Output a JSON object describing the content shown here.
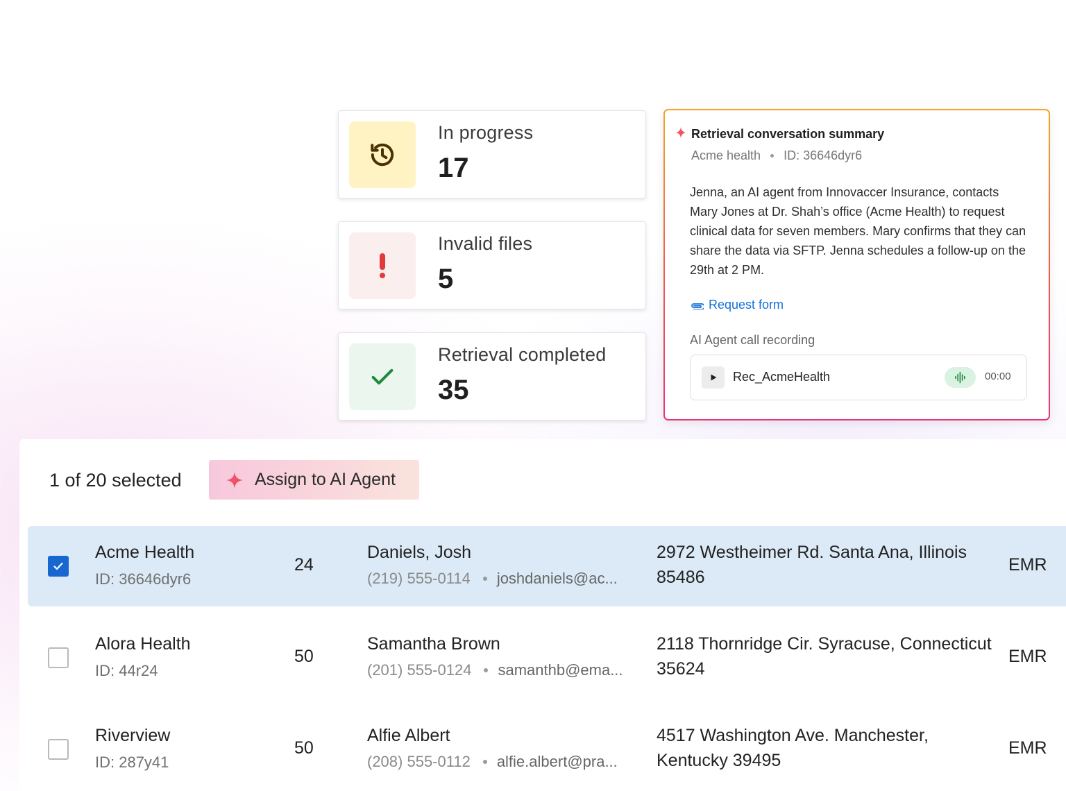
{
  "stats": {
    "in_progress": {
      "label": "In progress",
      "value": "17",
      "icon": "history-icon",
      "bg": "#fff3c4",
      "color": "#5c3d00"
    },
    "invalid_files": {
      "label": "Invalid files",
      "value": "5",
      "icon": "exclamation-icon",
      "bg": "#fbeeee",
      "color": "#e03a3a"
    },
    "retrieval_completed": {
      "label": "Retrieval completed",
      "value": "35",
      "icon": "checkmark-icon",
      "bg": "#eaf6ee",
      "color": "#1f8a3b"
    }
  },
  "summary": {
    "title": "Retrieval conversation summary",
    "org": "Acme health",
    "id": "ID: 36646dyr6",
    "body": "Jenna, an AI agent from Innovaccer Insurance, contacts Mary Jones at Dr. Shah’s office (Acme Health) to request clinical data for seven members. Mary confirms that they can share the data via SFTP. Jenna schedules a follow-up on the 29th at 2 PM.",
    "link_label": "Request form",
    "recording_heading": "AI Agent call recording",
    "recording": {
      "name": "Rec_AcmeHealth",
      "time": "00:00"
    }
  },
  "table": {
    "selection_text": "1 of 20 selected",
    "assign_label": "Assign to AI Agent",
    "rows": [
      {
        "selected": true,
        "org": "Acme Health",
        "id": "ID: 36646dyr6",
        "count": "24",
        "person": "Daniels, Josh",
        "phone": "(219) 555-0114",
        "email": "joshdaniels@ac...",
        "address": "2972 Westheimer Rd. Santa Ana, Illinois 85486",
        "source": "EMR"
      },
      {
        "selected": false,
        "org": "Alora Health",
        "id": "ID: 44r24",
        "count": "50",
        "person": "Samantha Brown",
        "phone": "(201) 555-0124",
        "email": "samanthb@ema...",
        "address": "2118 Thornridge Cir. Syracuse, Connecticut 35624",
        "source": "EMR"
      },
      {
        "selected": false,
        "org": "Riverview",
        "id": "ID: 287y41",
        "count": "50",
        "person": "Alfie Albert",
        "phone": "(208) 555-0112",
        "email": "alfie.albert@pra...",
        "address": "4517 Washington Ave. Manchester, Kentucky 39495",
        "source": "EMR"
      }
    ]
  },
  "colors": {
    "accent_blue": "#1867d1",
    "link_blue": "#1570d6",
    "selected_row": "#dbeaf6",
    "summary_border_gradient": [
      "#f5a524",
      "#f0584f",
      "#e8337a"
    ]
  }
}
